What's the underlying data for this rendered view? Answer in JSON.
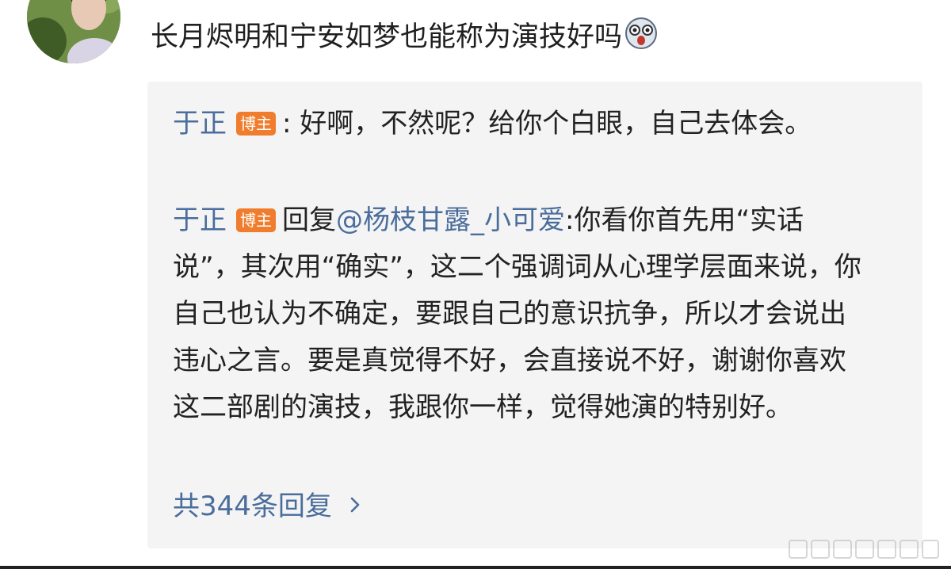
{
  "comment": {
    "avatar_icon": "avatar-icon",
    "text": "长月烬明和宁安如梦也能称为演技好吗",
    "emoji_icon": "shocked-face-icon"
  },
  "replies": [
    {
      "username": "于正",
      "badge": "博主",
      "separator": ":",
      "mention": "",
      "text": " 好啊，不然呢？给你个白眼，自己去体会。"
    },
    {
      "username": "于正",
      "badge": "博主",
      "separator": "回复",
      "mention": "@杨枝甘露_小可爱",
      "text": ":你看你首先用“实话说”，其次用“确实”，这二个强调词从心理学层面来说，你自己也认为不确定，要跟自己的意识抗争，所以才会说出违心之言。要是真觉得不好，会直接说不好，谢谢你喜欢这二部剧的演技，我跟你一样，觉得她演的特别好。"
    }
  ],
  "more_replies": {
    "label": "共344条回复",
    "icon": "chevron-right-icon"
  },
  "colors": {
    "link": "#4a6d9c",
    "badge": "#f07d2d",
    "reply_bg": "#f4f4f4"
  }
}
